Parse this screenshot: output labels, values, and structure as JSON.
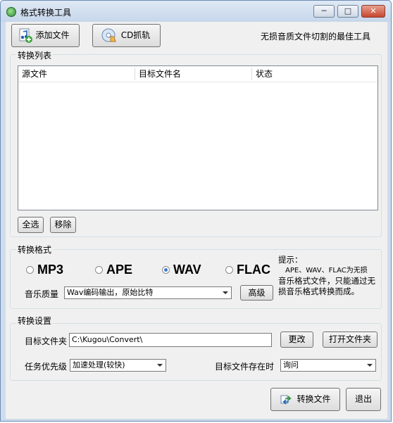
{
  "window": {
    "title": "格式转换工具",
    "min_glyph": "─",
    "max_glyph": "□",
    "close_glyph": "✕"
  },
  "toolbar": {
    "add_file_label": "添加文件",
    "cd_rip_label": "CD抓轨",
    "tagline": "无损音质文件切割的最佳工具"
  },
  "convert_list": {
    "group_label": "转换列表",
    "columns": [
      "源文件",
      "目标文件名",
      "状态"
    ],
    "select_all_label": "全选",
    "remove_label": "移除"
  },
  "format": {
    "group_label": "转换格式",
    "options": [
      "MP3",
      "APE",
      "WAV",
      "FLAC"
    ],
    "selected": "WAV",
    "quality_label": "音乐质量",
    "quality_value": "Wav编码输出，原始比特",
    "advanced_label": "高级",
    "hint_title": "提示：",
    "hint_line2": "APE、WAV、FLAC为无损",
    "hint_line3": "音乐格式文件，只能通过无",
    "hint_line4": "损音乐格式转换而成。"
  },
  "settings": {
    "group_label": "转换设置",
    "target_folder_label": "目标文件夹",
    "target_folder_value": "C:\\Kugou\\Convert\\",
    "change_label": "更改",
    "open_folder_label": "打开文件夹",
    "priority_label": "任务优先级",
    "priority_value": "加速处理(较快)",
    "exists_label": "目标文件存在时",
    "exists_value": "询问"
  },
  "footer": {
    "convert_label": "转换文件",
    "exit_label": "退出"
  },
  "colors": {
    "title_bg": "#cfdcec",
    "client_bg": "#f0f0f0",
    "radio_on": "#3c7ad6",
    "close_red": "#c7462f"
  }
}
